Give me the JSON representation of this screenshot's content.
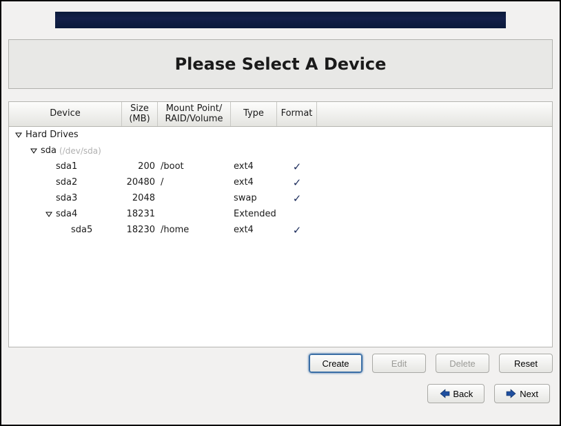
{
  "title": "Please Select A Device",
  "columns": {
    "device": "Device",
    "size": "Size\n(MB)",
    "mount": "Mount Point/\nRAID/Volume",
    "type": "Type",
    "format": "Format"
  },
  "tree": [
    {
      "indent": 0,
      "expander": true,
      "label": "Hard Drives"
    },
    {
      "indent": 1,
      "expander": true,
      "label": "sda",
      "path": "(/dev/sda)"
    },
    {
      "indent": 2,
      "label": "sda1",
      "size": "200",
      "mount": "/boot",
      "type": "ext4",
      "format": true
    },
    {
      "indent": 2,
      "label": "sda2",
      "size": "20480",
      "mount": "/",
      "type": "ext4",
      "format": true
    },
    {
      "indent": 2,
      "label": "sda3",
      "size": "2048",
      "mount": "",
      "type": "swap",
      "format": true
    },
    {
      "indent": 2,
      "expander": true,
      "label": "sda4",
      "size": "18231",
      "mount": "",
      "type": "Extended"
    },
    {
      "indent": 3,
      "label": "sda5",
      "size": "18230",
      "mount": "/home",
      "type": "ext4",
      "format": true
    }
  ],
  "actions": {
    "create": "Create",
    "edit": "Edit",
    "delete": "Delete",
    "reset": "Reset"
  },
  "nav": {
    "back": "Back",
    "next": "Next"
  }
}
